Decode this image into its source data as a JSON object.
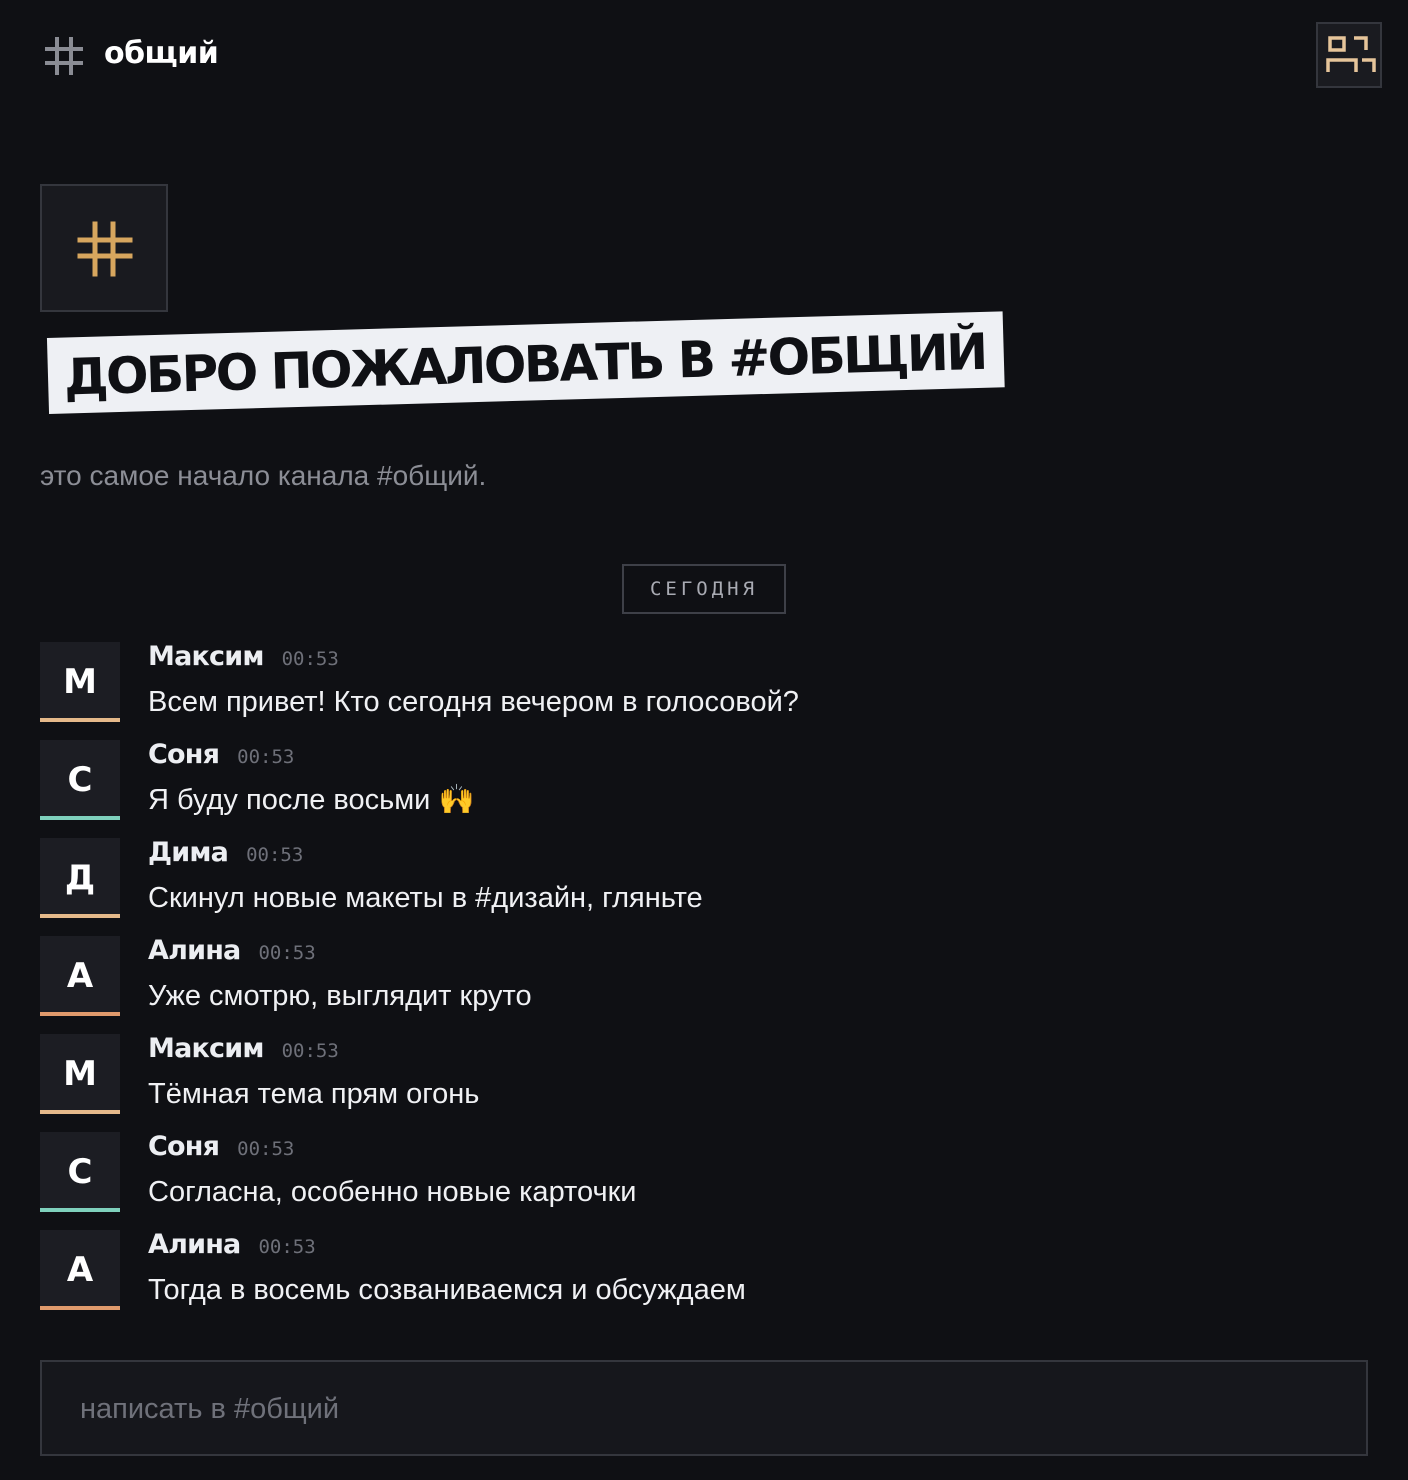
{
  "header": {
    "title": "общий",
    "hash_icon": "hash-icon",
    "members_icon": "members-icon"
  },
  "welcome": {
    "title": "ДОБРО ПОЖАЛОВАТЬ В #ОБЩИЙ",
    "subtitle": "это самое начало канала #общий."
  },
  "date_divider": "СЕГОДНЯ",
  "messages": [
    {
      "initial": "М",
      "author": "Максим",
      "time": "00:53",
      "text": "Всем привет! Кто сегодня вечером в голосовой?",
      "color": "#e5b98a"
    },
    {
      "initial": "С",
      "author": "Соня",
      "time": "00:53",
      "text": "Я буду после восьми 🙌",
      "color": "#7fd1bd"
    },
    {
      "initial": "Д",
      "author": "Дима",
      "time": "00:53",
      "text": "Скинул новые макеты в #дизайн, гляньте",
      "color": "#e5b98a"
    },
    {
      "initial": "А",
      "author": "Алина",
      "time": "00:53",
      "text": "Уже смотрю, выглядит круто",
      "color": "#e09a6c"
    },
    {
      "initial": "М",
      "author": "Максим",
      "time": "00:53",
      "text": "Тёмная тема прям огонь",
      "color": "#e5b98a"
    },
    {
      "initial": "С",
      "author": "Соня",
      "time": "00:53",
      "text": "Согласна, особенно новые карточки",
      "color": "#7fd1bd"
    },
    {
      "initial": "А",
      "author": "Алина",
      "time": "00:53",
      "text": "Тогда в восемь созваниваемся и обсуждаем",
      "color": "#e09a6c"
    }
  ],
  "composer": {
    "placeholder": "написать в #общий",
    "value": ""
  },
  "colors": {
    "accent": "#d7a65e",
    "background": "#0f1014"
  }
}
